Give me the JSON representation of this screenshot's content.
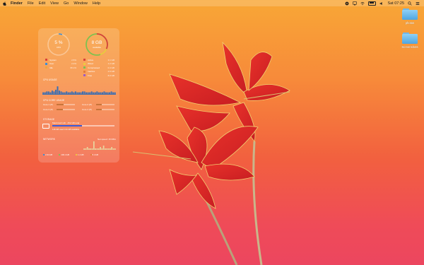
{
  "menubar": {
    "items": [
      "Finder",
      "File",
      "Edit",
      "View",
      "Go",
      "Window",
      "Help"
    ],
    "clock": "Sat 07:25"
  },
  "desktop": {
    "folders": [
      {
        "label": "photos"
      },
      {
        "label": "Screenshots"
      }
    ]
  },
  "widget": {
    "cpu": {
      "value": "5 %",
      "sub": "CPU"
    },
    "memory": {
      "value": "8 GB",
      "sub": "available"
    },
    "cpu_legend": [
      {
        "name": "System",
        "value": "2.5%",
        "color": "#d9413a"
      },
      {
        "name": "User",
        "value": "2.4%",
        "color": "#3a8fd9"
      },
      {
        "name": "Idle",
        "value": "95.1%",
        "color": "#f0a53e"
      }
    ],
    "memory_legend": [
      {
        "name": "Active",
        "value": "3.1 GB",
        "color": "#d9413a"
      },
      {
        "name": "Wired",
        "value": "1.2 GB",
        "color": "#f0c93e"
      },
      {
        "name": "Compressed",
        "value": "0.4 GB",
        "color": "#7fc14f"
      },
      {
        "name": "Inactive",
        "value": "2.6 GB",
        "color": "#e37d3a"
      },
      {
        "name": "Free",
        "value": "8.0 GB",
        "color": "#9b5cc9"
      }
    ],
    "cpu_usage_title": "CPU USAGE",
    "cpu_bars": [
      2,
      2,
      3,
      3,
      2,
      4,
      3,
      5,
      9,
      4,
      3,
      2,
      2,
      3,
      2,
      2,
      3,
      2,
      3,
      2,
      2,
      2,
      3,
      3,
      2,
      2,
      2,
      3,
      2,
      2,
      3,
      2,
      2,
      2,
      3,
      2,
      2,
      2,
      3,
      2,
      2
    ],
    "cpu_core_title": "CPU CORE USAGE",
    "cores": [
      {
        "label": "Core 1 (P)",
        "value": 0.4
      },
      {
        "label": "Core 2 (P)",
        "value": 0.3
      },
      {
        "label": "Core 3 (P)",
        "value": 0.35
      },
      {
        "label": "Core 4 (P)",
        "value": 0.3
      }
    ],
    "storage_title": "STORAGE",
    "storage_caption": "Macintosh HD - 252 GB total",
    "storage_detail": "118 GB used  134 GB available",
    "network_title": "NETWORK",
    "network_detail": "Net speed: 15 KB/s",
    "network_stats": [
      {
        "label": "2.64 kB",
        "color": "#3a8fd9"
      },
      {
        "label": "103.4 kB",
        "color": "#7fc14f"
      },
      {
        "label": "1.4 kB",
        "color": "#f0c93e"
      },
      {
        "label": "5.4 kB",
        "color": "#e37d3a"
      }
    ],
    "network_bars": [
      1,
      1,
      2,
      1,
      1,
      1,
      6,
      1,
      1,
      1,
      2,
      1,
      3,
      1,
      1,
      1,
      1,
      2,
      1,
      1
    ]
  }
}
